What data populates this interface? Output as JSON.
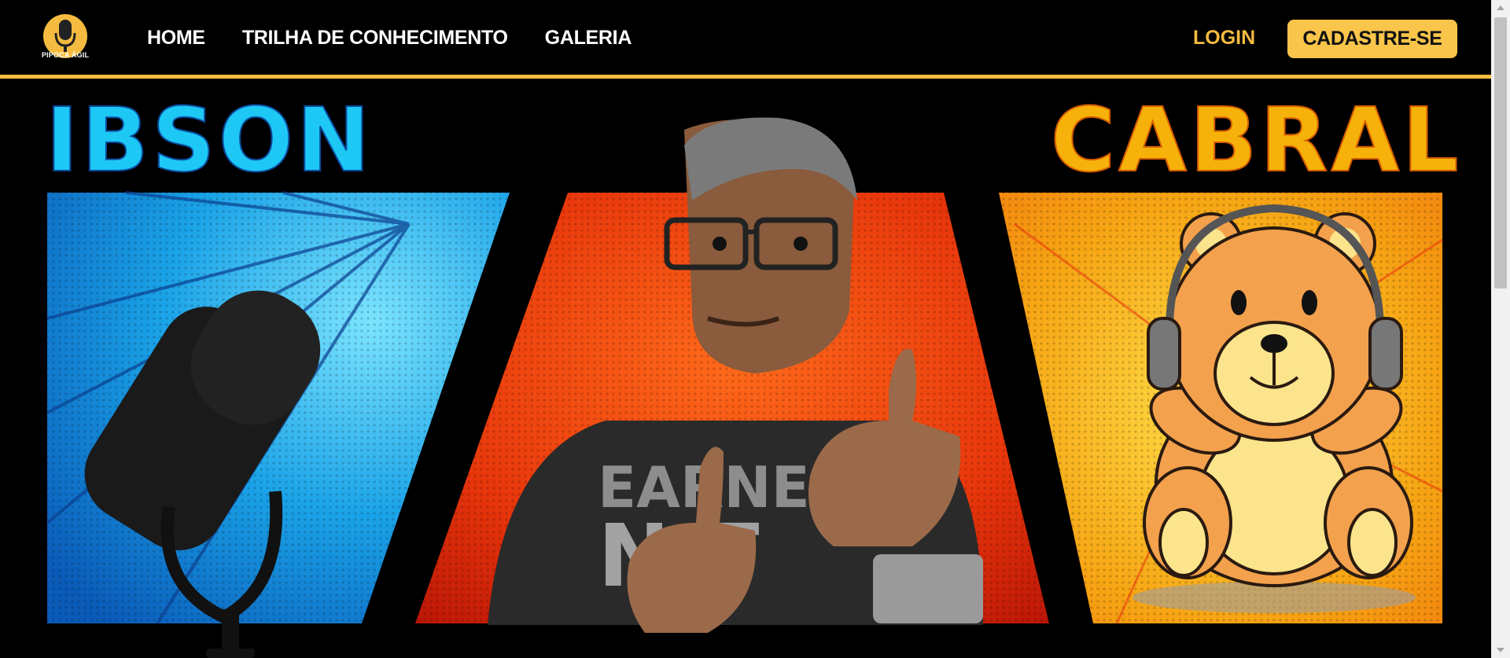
{
  "brand": {
    "logo_text": "PIPOCA ÁGIL"
  },
  "nav": {
    "items": [
      {
        "label": "HOME"
      },
      {
        "label": "TRILHA DE CONHECIMENTO"
      },
      {
        "label": "GALERIA"
      }
    ],
    "login_label": "LOGIN",
    "signup_label": "CADASTRE-SE"
  },
  "hero": {
    "name_left": "IBSON",
    "name_right": "CABRAL",
    "panels": [
      {
        "name": "microphone-panel",
        "color": "#1aa3e8"
      },
      {
        "name": "portrait-panel",
        "color": "#e8360b"
      },
      {
        "name": "teddy-bear-panel",
        "color": "#f7a614"
      }
    ]
  },
  "colors": {
    "accent": "#f4bb40",
    "background": "#000000"
  }
}
